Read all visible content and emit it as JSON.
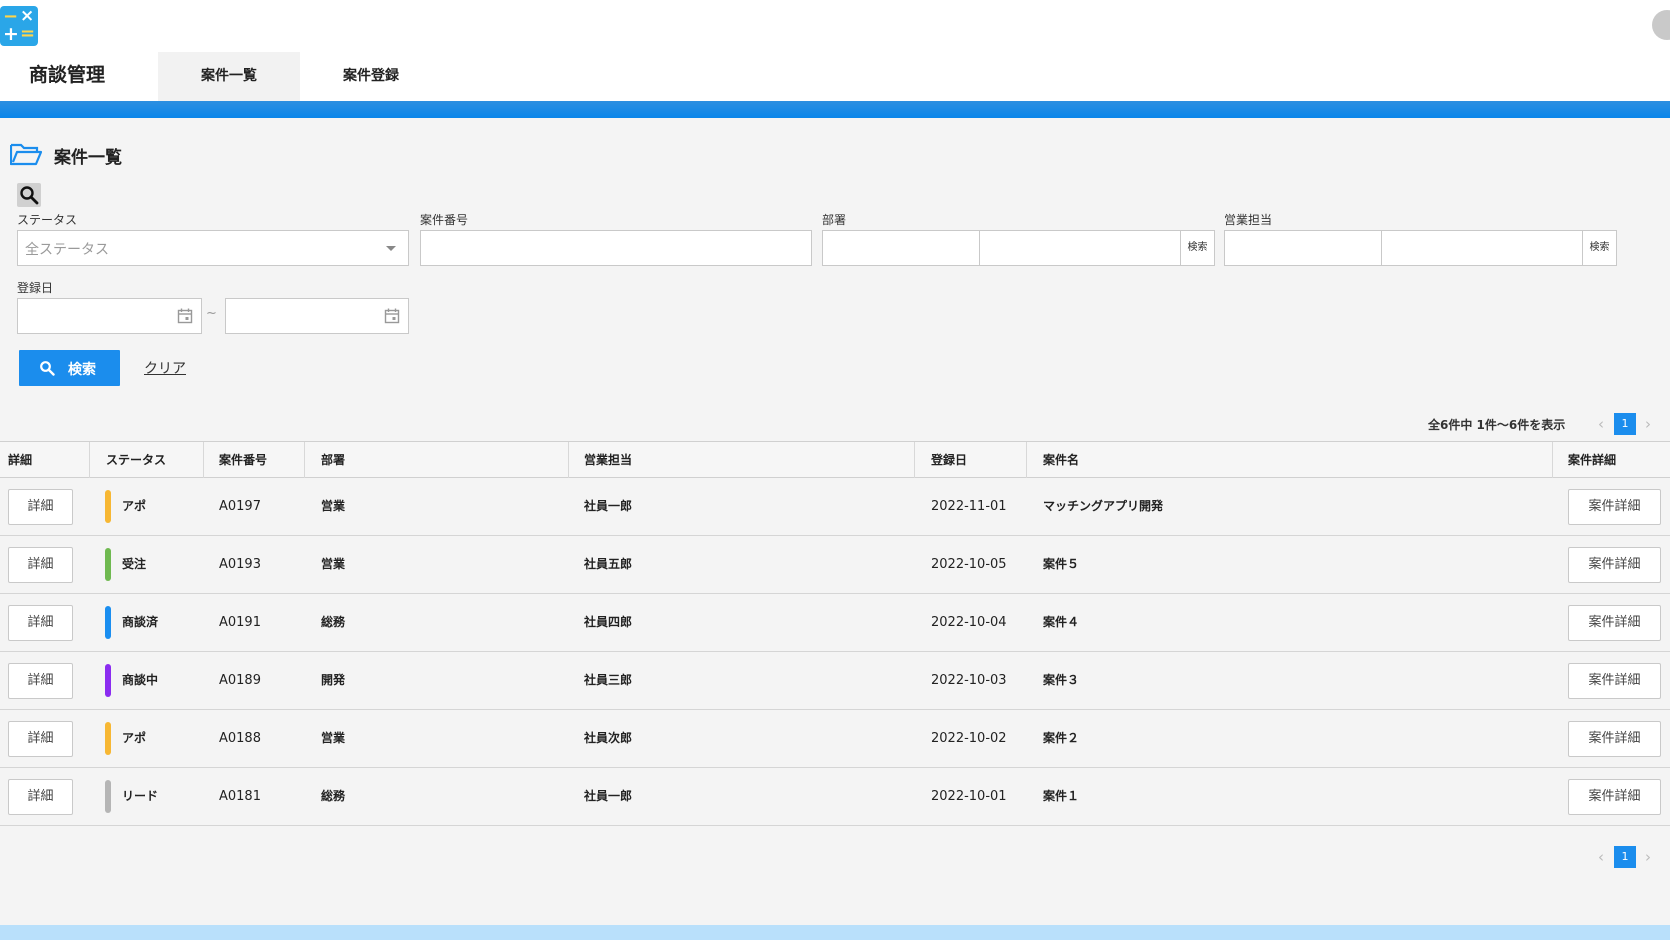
{
  "header": {
    "app_icon_glyphs": [
      "−",
      "×",
      "+",
      "="
    ],
    "app_title": "商談管理",
    "tabs": [
      {
        "label": "案件一覧",
        "active": true
      },
      {
        "label": "案件登録",
        "active": false
      }
    ]
  },
  "page": {
    "title": "案件一覧"
  },
  "filters": {
    "status": {
      "label": "ステータス",
      "value": "全ステータス"
    },
    "case_number": {
      "label": "案件番号",
      "value": ""
    },
    "department": {
      "label": "部署",
      "button": "検索"
    },
    "sales_rep": {
      "label": "営業担当",
      "button": "検索"
    },
    "registered_date": {
      "label": "登録日",
      "separator": "~"
    },
    "search_button": "検索",
    "clear_link": "クリア"
  },
  "results": {
    "count_text": "全6件中 1件〜6件を表示",
    "current_page": "1",
    "prev_icon": "chevron-left-icon",
    "next_icon": "chevron-right-icon"
  },
  "table": {
    "headers": [
      "詳細",
      "ステータス",
      "案件番号",
      "部署",
      "営業担当",
      "登録日",
      "案件名",
      "案件詳細"
    ],
    "rows": [
      {
        "detail_btn": "詳細",
        "status": "アポ",
        "status_color": "#f7b733",
        "number": "A0197",
        "dept": "営業",
        "rep": "社員一郎",
        "date": "2022-11-01",
        "name": "マッチングアプリ開発",
        "case_btn": "案件詳細"
      },
      {
        "detail_btn": "詳細",
        "status": "受注",
        "status_color": "#6fb950",
        "number": "A0193",
        "dept": "営業",
        "rep": "社員五郎",
        "date": "2022-10-05",
        "name": "案件５",
        "case_btn": "案件詳細"
      },
      {
        "detail_btn": "詳細",
        "status": "商談済",
        "status_color": "#1a8ef0",
        "number": "A0191",
        "dept": "総務",
        "rep": "社員四郎",
        "date": "2022-10-04",
        "name": "案件４",
        "case_btn": "案件詳細"
      },
      {
        "detail_btn": "詳細",
        "status": "商談中",
        "status_color": "#8b2cf0",
        "number": "A0189",
        "dept": "開発",
        "rep": "社員三郎",
        "date": "2022-10-03",
        "name": "案件３",
        "case_btn": "案件詳細"
      },
      {
        "detail_btn": "詳細",
        "status": "アポ",
        "status_color": "#f7b733",
        "number": "A0188",
        "dept": "営業",
        "rep": "社員次郎",
        "date": "2022-10-02",
        "name": "案件２",
        "case_btn": "案件詳細"
      },
      {
        "detail_btn": "詳細",
        "status": "リード",
        "status_color": "#b5b5b5",
        "number": "A0181",
        "dept": "総務",
        "rep": "社員一郎",
        "date": "2022-10-01",
        "name": "案件１",
        "case_btn": "案件詳細"
      }
    ]
  },
  "colors": {
    "accent": "#1b8ded",
    "header_band": "#0a86ea",
    "footer_band": "#b9e0fb"
  }
}
